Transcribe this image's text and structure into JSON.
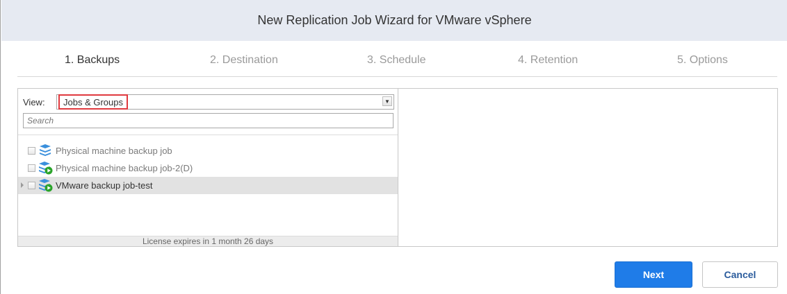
{
  "window": {
    "title": "New Replication Job Wizard for VMware vSphere"
  },
  "steps": [
    {
      "label": "1. Backups",
      "active": true
    },
    {
      "label": "2. Destination",
      "active": false
    },
    {
      "label": "3. Schedule",
      "active": false
    },
    {
      "label": "4. Retention",
      "active": false
    },
    {
      "label": "5. Options",
      "active": false
    }
  ],
  "left_panel": {
    "view_label": "View:",
    "view_selected": "Jobs & Groups",
    "search_placeholder": "Search",
    "items": [
      {
        "label": "Physical machine backup job",
        "icon": "backup-job-icon",
        "status": "inactive"
      },
      {
        "label": "Physical machine backup job-2(D)",
        "icon": "backup-job-active-icon",
        "status": "inactive"
      },
      {
        "label": "VMware backup job-test",
        "icon": "backup-job-active-icon",
        "status": "selected"
      }
    ],
    "license_text": "License expires in 1 month 26 days"
  },
  "buttons": {
    "next": "Next",
    "cancel": "Cancel"
  },
  "colors": {
    "accent": "#1f7ce8",
    "highlight_border": "#e0393e",
    "titlebar_bg": "#e6eaf2",
    "icon_blue": "#3a8fdc",
    "icon_green": "#2aa32a"
  }
}
